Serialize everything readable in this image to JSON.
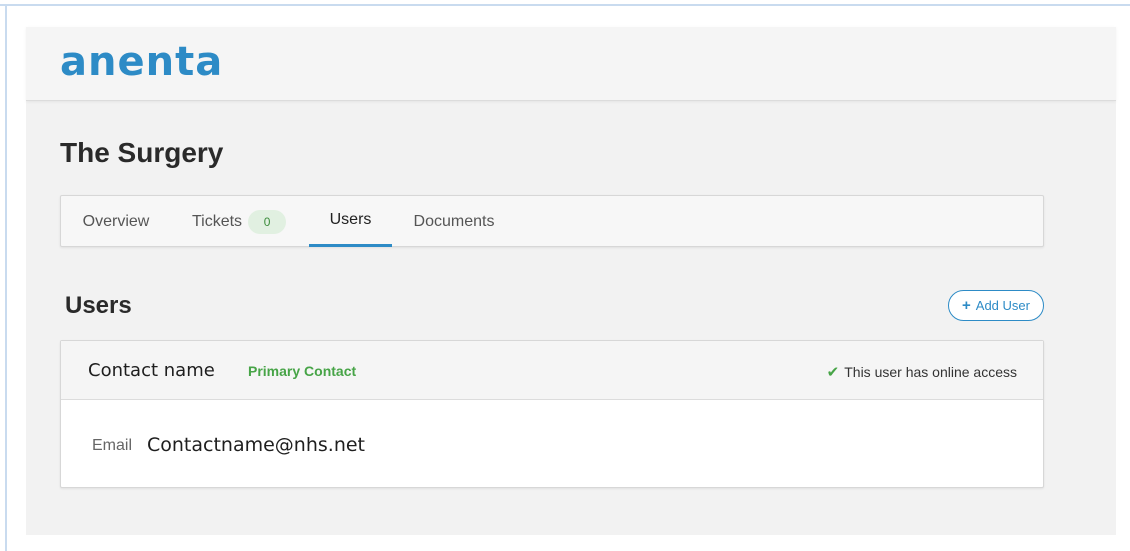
{
  "header": {
    "logo_text": "anenta"
  },
  "page": {
    "title": "The Surgery"
  },
  "tabs": [
    {
      "label": "Overview"
    },
    {
      "label": "Tickets",
      "badge": "0"
    },
    {
      "label": "Users",
      "active": true
    },
    {
      "label": "Documents"
    }
  ],
  "users_section": {
    "title": "Users",
    "add_button_icon": "+",
    "add_button_label": "Add User"
  },
  "user_card": {
    "name": "Contact name",
    "role_badge": "Primary Contact",
    "access_icon": "check-icon",
    "access_text": "This user has online access",
    "email_label": "Email",
    "email_value": "Contactname@nhs.net"
  },
  "colors": {
    "accent": "#2d8bc6",
    "success": "#47a447",
    "background": "#f2f2f2"
  }
}
